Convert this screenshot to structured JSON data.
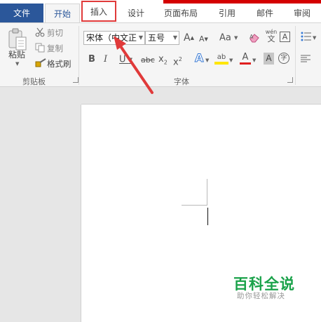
{
  "tabs": {
    "file": "文件",
    "home": "开始",
    "insert": "插入",
    "design": "设计",
    "layout": "页面布局",
    "references": "引用",
    "mailings": "邮件",
    "review": "审阅"
  },
  "clipboard": {
    "paste": "粘贴",
    "cut": "剪切",
    "copy": "复制",
    "format_painter": "格式刷",
    "group_label": "剪贴板"
  },
  "font": {
    "font_name": "宋体（中文正",
    "font_size": "五号",
    "grow_glyph": "A",
    "shrink_glyph": "A",
    "case_glyph": "Aa",
    "phonetic_top": "wén",
    "phonetic_bottom": "文",
    "border_glyph": "A",
    "bold": "B",
    "italic": "I",
    "underline": "U",
    "strike": "abc",
    "subscript_base": "x",
    "subscript_sub": "2",
    "superscript_base": "x",
    "superscript_sup": "2",
    "effects_glyph": "A",
    "highlight_glyph": "ab",
    "color_glyph": "A",
    "shading_glyph": "A",
    "enclose_glyph": "字",
    "group_label": "字体"
  },
  "colors": {
    "file_tab": "#2b579a",
    "accent_red": "#d40000",
    "annotation_red": "#e03a3a",
    "highlight_yellow": "#ffe600",
    "font_red": "#e02020",
    "watermark_green": "#1aa24a"
  },
  "icons": {
    "paste": "clipboard-icon",
    "cut": "scissors-icon",
    "copy": "copy-icon",
    "format_painter": "brush-icon",
    "clear_format": "eraser-icon",
    "bullets": "bullet-list-icon",
    "align": "align-left-icon"
  },
  "watermark": {
    "title": "百科全说",
    "subtitle": "助你轻松解决"
  }
}
